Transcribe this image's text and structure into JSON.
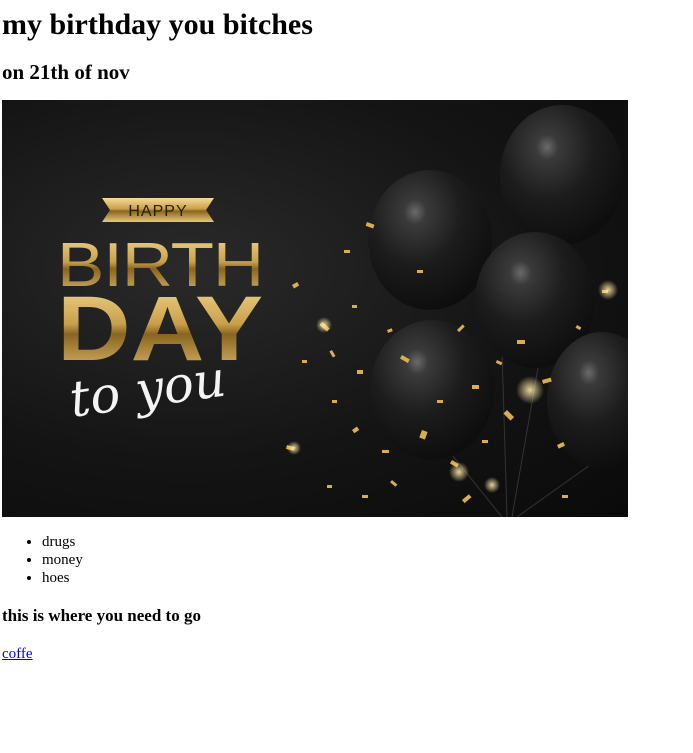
{
  "heading": "my birthday you bitches",
  "subheading": "on 21th of nov",
  "banner": {
    "ribbon_text": "HAPPY",
    "line1": "BIRTH",
    "line2": "DAY",
    "script_text": "to you",
    "colors": {
      "gold": "#c9a04a",
      "gold_light": "#f2d58a",
      "background": "#141414",
      "balloon": "#1d1d1d"
    }
  },
  "list": {
    "items": [
      "drugs",
      "money",
      "hoes"
    ]
  },
  "section_heading": "this is where you need to go",
  "link": {
    "label": "coffe"
  }
}
